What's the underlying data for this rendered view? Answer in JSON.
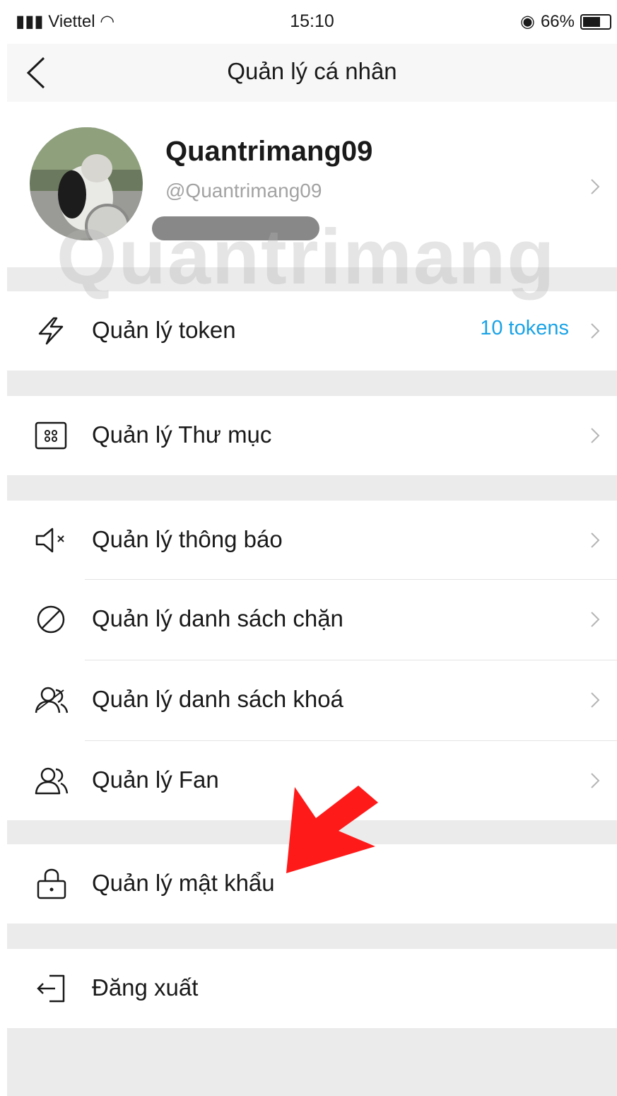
{
  "status_bar": {
    "carrier": "Viettel",
    "time": "15:10",
    "battery": "66%"
  },
  "nav": {
    "title": "Quản lý cá nhân"
  },
  "profile": {
    "name": "Quantrimang09",
    "handle": "@Quantrimang09"
  },
  "watermark": "Quantrimang",
  "menu": {
    "token": {
      "label": "Quản lý token",
      "value": "10 tokens"
    },
    "folder": {
      "label": "Quản lý Thư mục"
    },
    "notifications": {
      "label": "Quản lý thông báo"
    },
    "blocklist": {
      "label": "Quản lý danh sách chặn"
    },
    "locklist": {
      "label": "Quản lý danh sách khoá"
    },
    "fan": {
      "label": "Quản lý Fan"
    },
    "password": {
      "label": "Quản lý mật khẩu"
    },
    "logout": {
      "label": "Đăng xuất"
    }
  },
  "colors": {
    "accent": "#1aa3e6",
    "arrow": "#ff1a1a",
    "section_gap": "#ebebeb"
  },
  "icons": [
    "back-icon",
    "bolt-icon",
    "folder-icon",
    "mute-icon",
    "block-icon",
    "lock-users-icon",
    "users-icon",
    "lock-icon",
    "logout-icon",
    "chevron-right-icon"
  ]
}
